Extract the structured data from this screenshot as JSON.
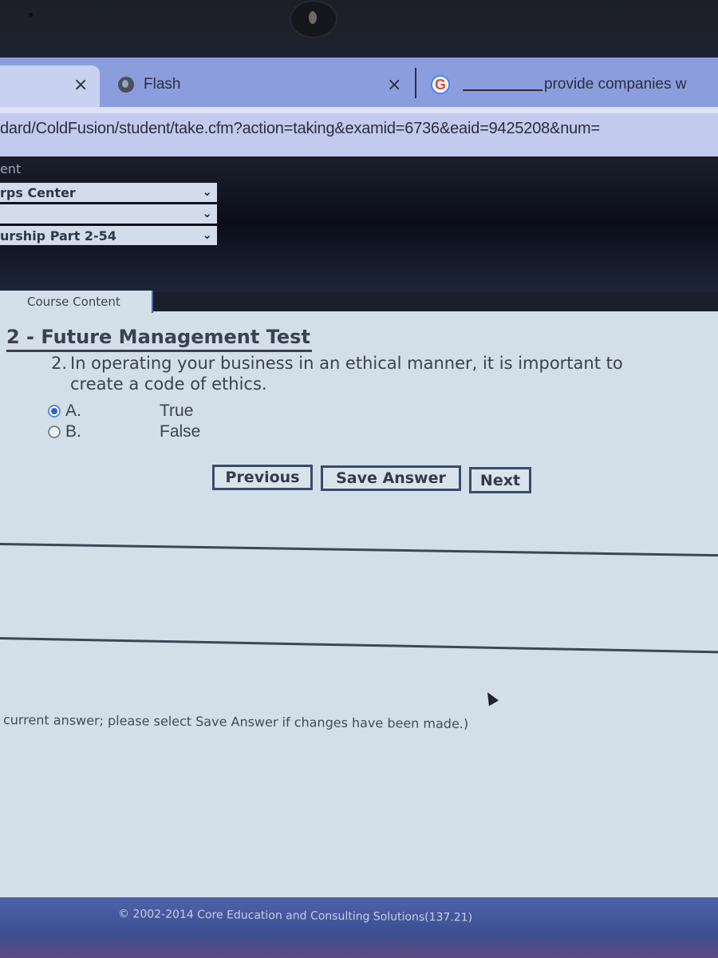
{
  "browser": {
    "tabs": [
      {
        "label": "",
        "active": true,
        "icon": "none"
      },
      {
        "label": "Flash",
        "active": false,
        "icon": "globe-icon"
      },
      {
        "label": "provide companies w",
        "active": false,
        "icon": "google-icon",
        "blank_prefix": "________"
      }
    ],
    "google_glyph": "G",
    "close_glyph": "×",
    "url": "dard/ColdFusion/student/take.cfm?action=taking&examid=6736&eaid=9425208&num="
  },
  "site_header": {
    "label": "ent",
    "selects": [
      {
        "value": "rps Center"
      },
      {
        "value": ""
      },
      {
        "value": "urship Part 2-54"
      }
    ],
    "chevron_glyph": "❯"
  },
  "content": {
    "course_tab": "Course Content",
    "test_title": "2 - Future Management Test",
    "question": {
      "number": "2.",
      "text_line1": "In operating your business in an ethical manner, it is important to",
      "text_line2": "create a code of ethics."
    },
    "options": [
      {
        "letter": "A.",
        "text": "True",
        "selected": true
      },
      {
        "letter": "B.",
        "text": "False",
        "selected": false
      }
    ],
    "buttons": {
      "previous": "Previous",
      "save": "Save Answer",
      "next": "Next"
    },
    "note": "current answer; please select Save Answer if changes have been made.)"
  },
  "footer": {
    "copyright": "© 2002-2014 Core Education and Consulting Solutions(137.21)"
  }
}
